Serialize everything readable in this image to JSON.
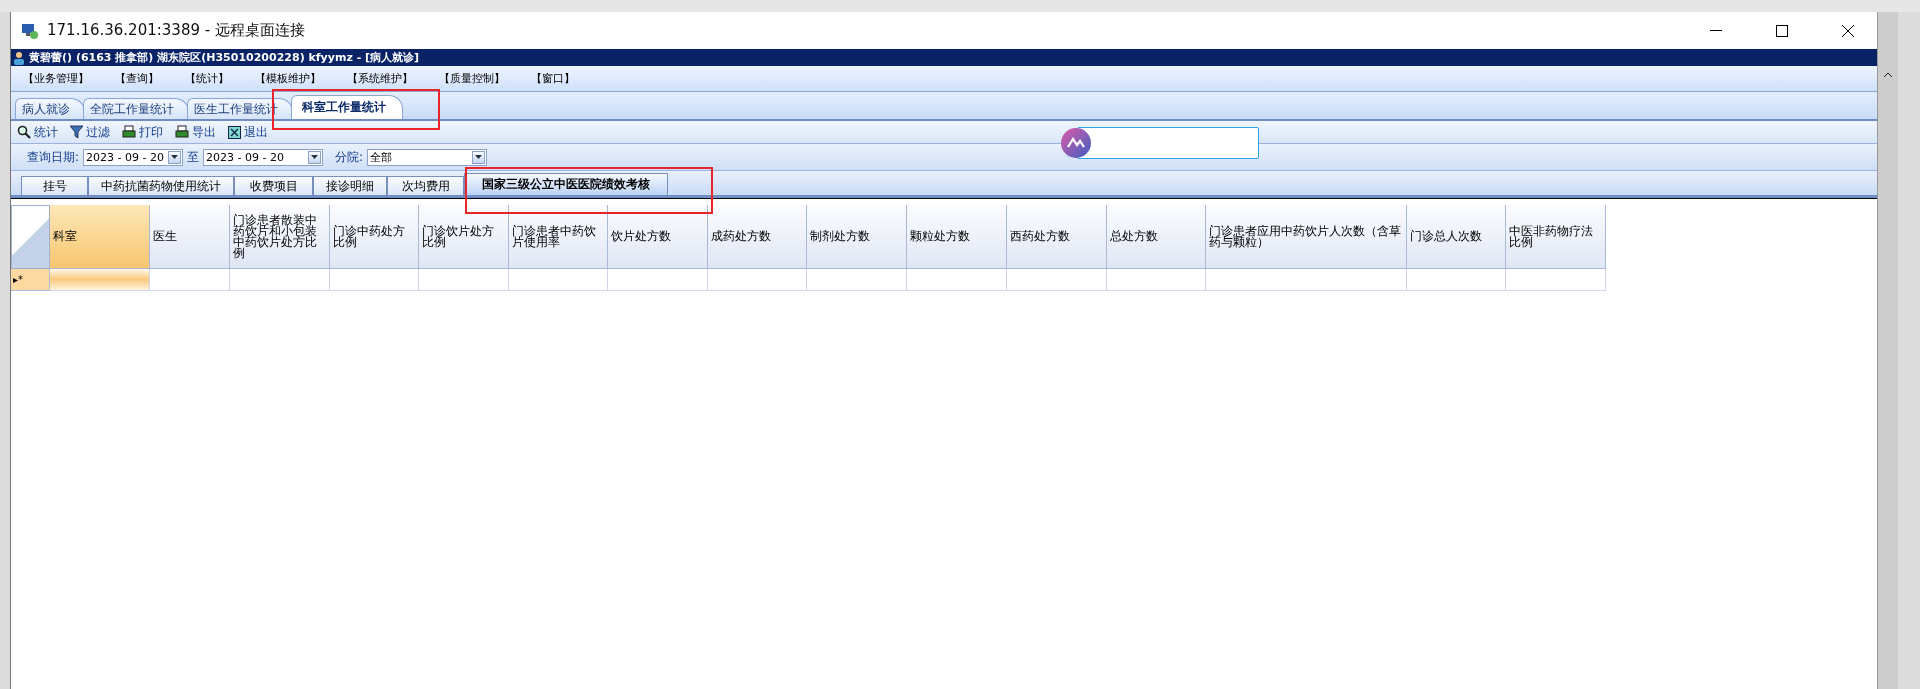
{
  "window": {
    "title": "171.16.36.201:3389 - 远程桌面连接"
  },
  "app": {
    "title": "黄碧蕾() (6163 推拿部) 湖东院区(H35010200228) kfyymz - [病人就诊]"
  },
  "menu": [
    "【业务管理】",
    "【查询】",
    "【统计】",
    "【模板维护】",
    "【系统维护】",
    "【质量控制】",
    "【窗口】"
  ],
  "tabs": [
    {
      "label": "病人就诊",
      "selected": false
    },
    {
      "label": "全院工作量统计",
      "selected": false
    },
    {
      "label": "医生工作量统计",
      "selected": false
    },
    {
      "label": "科室工作量统计",
      "selected": true
    }
  ],
  "toolbar": [
    {
      "label": "统计",
      "kind": "search"
    },
    {
      "label": "过滤",
      "kind": "filter"
    },
    {
      "label": "打印",
      "kind": "print"
    },
    {
      "label": "导出",
      "kind": "export"
    },
    {
      "label": "退出",
      "kind": "exit"
    }
  ],
  "query": {
    "date_label": "查询日期:",
    "date_from": "2023 - 09 - 20",
    "to_label": "至",
    "date_to": "2023 - 09 - 20",
    "branch_label": "分院:",
    "branch": "全部"
  },
  "subtabs": [
    {
      "label": "挂号",
      "selected": false
    },
    {
      "label": "中药抗菌药物使用统计",
      "selected": false
    },
    {
      "label": "收费项目",
      "selected": false
    },
    {
      "label": "接诊明细",
      "selected": false
    },
    {
      "label": "次均费用",
      "selected": false
    },
    {
      "label": "国家三级公立中医医院绩效考核",
      "selected": true
    }
  ],
  "table": {
    "columns": [
      "科室",
      "医生",
      "门诊患者散装中药饮片和小包装中药饮片处方比例",
      "门诊中药处方比例",
      "门诊饮片处方比例",
      "门诊患者中药饮片使用率",
      "饮片处方数",
      "成药处方数",
      "制剂处方数",
      "颗粒处方数",
      "西药处方数",
      "总处方数",
      "门诊患者应用中药饮片人次数（含草药与颗粒）",
      "门诊总人次数",
      "中医非药物疗法比例"
    ],
    "new_row_marker": "▸*"
  }
}
